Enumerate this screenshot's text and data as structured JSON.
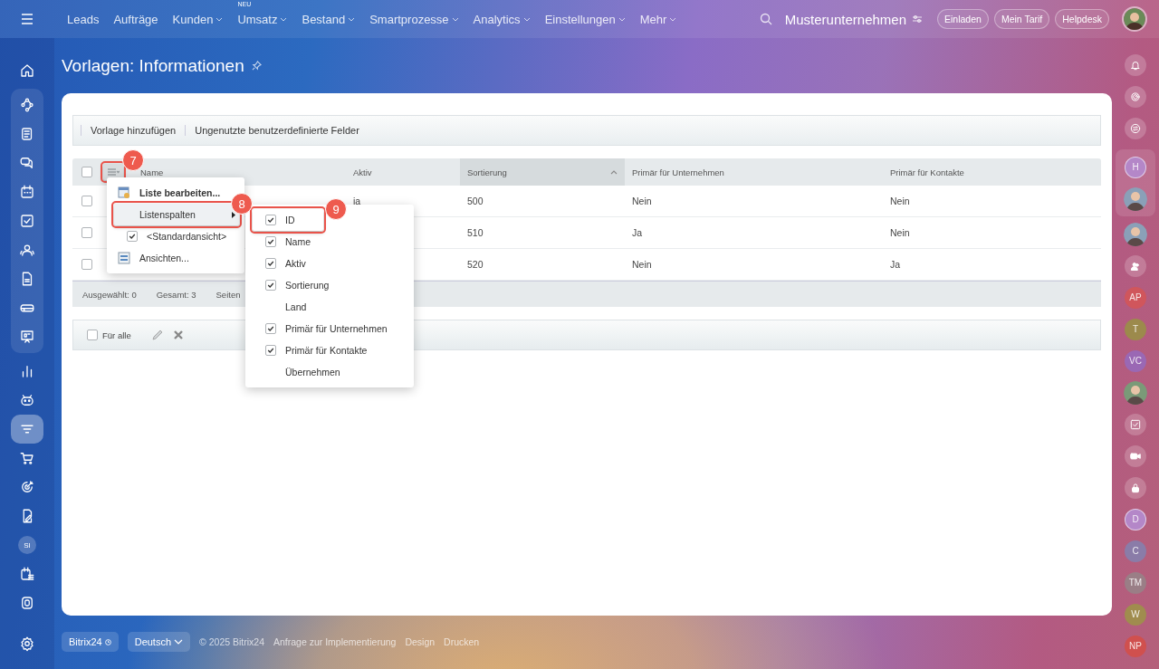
{
  "top_bar": {
    "nav": [
      {
        "label": "Leads",
        "dropdown": false
      },
      {
        "label": "Aufträge",
        "dropdown": false
      },
      {
        "label": "Kunden",
        "dropdown": true
      },
      {
        "label": "Umsatz",
        "dropdown": true,
        "badge": "NEU"
      },
      {
        "label": "Bestand",
        "dropdown": true
      },
      {
        "label": "Smartprozesse",
        "dropdown": true
      },
      {
        "label": "Analytics",
        "dropdown": true
      },
      {
        "label": "Einstellungen",
        "dropdown": true
      },
      {
        "label": "Mehr",
        "dropdown": true
      }
    ],
    "company": "Musterunternehmen",
    "buttons": [
      "Einladen",
      "Mein Tarif",
      "Helpdesk"
    ]
  },
  "left_sidebar": {
    "top": [
      {
        "kind": "home"
      }
    ],
    "group": [
      {
        "kind": "flow"
      },
      {
        "kind": "news"
      },
      {
        "kind": "chat"
      },
      {
        "kind": "calendar"
      },
      {
        "kind": "task"
      },
      {
        "kind": "people"
      },
      {
        "kind": "document"
      },
      {
        "kind": "drive"
      },
      {
        "kind": "board"
      }
    ],
    "rest": [
      {
        "kind": "chart",
        "selected": false
      },
      {
        "kind": "robot",
        "selected": false
      },
      {
        "kind": "filter",
        "selected": true
      },
      {
        "kind": "cart",
        "selected": false
      },
      {
        "kind": "target",
        "selected": false
      },
      {
        "kind": "sign",
        "selected": false
      },
      {
        "kind": "initials",
        "text": "SI"
      },
      {
        "kind": "schedule",
        "selected": false
      },
      {
        "kind": "shield",
        "selected": false
      }
    ],
    "bottom": [
      {
        "kind": "settings"
      }
    ]
  },
  "page_title": "Vorlagen: Informationen",
  "toolbar": [
    "Vorlage hinzufügen",
    "Ungenutzte benutzerdefinierte Felder"
  ],
  "table": {
    "settings_callout": "7",
    "select_all_checked": false,
    "columns": [
      {
        "label": "Name",
        "sorted": false
      },
      {
        "label": "Aktiv",
        "sorted": false
      },
      {
        "label": "Sortierung",
        "sorted": true
      },
      {
        "label": "Primär für Unternehmen",
        "sorted": false
      },
      {
        "label": "Primär für Kontakte",
        "sorted": false
      }
    ],
    "rows": [
      {
        "checked": false,
        "cells": [
          "",
          "ja",
          "500",
          "Nein",
          "Nein"
        ]
      },
      {
        "checked": false,
        "cells": [
          "",
          "",
          "510",
          "Ja",
          "Nein"
        ]
      },
      {
        "checked": false,
        "cells": [
          "",
          "",
          "520",
          "Nein",
          "Ja"
        ]
      }
    ],
    "footer": [
      "Ausgewählt: 0",
      "Gesamt: 3",
      "Seiten"
    ]
  },
  "bottom_toolbar": {
    "label": "Für alle",
    "checked": false
  },
  "settings_menu": {
    "items": [
      {
        "kind": "edit",
        "label": "Liste bearbeiten...",
        "selected": false
      },
      {
        "kind": "submenu",
        "label": "Listenspalten",
        "callout": "8",
        "selected": true
      },
      {
        "kind": "check",
        "label": "<Standardansicht>",
        "checked": true,
        "selected": false
      },
      {
        "kind": "views",
        "label": "Ansichten...",
        "selected": false
      }
    ]
  },
  "columns_menu": {
    "items": [
      {
        "label": "ID",
        "checked": true,
        "callout": "9"
      },
      {
        "label": "Name",
        "checked": true
      },
      {
        "label": "Aktiv",
        "checked": true
      },
      {
        "label": "Sortierung",
        "checked": true
      },
      {
        "label": "Land",
        "checked": false
      },
      {
        "label": "Primär für Unternehmen",
        "checked": true
      },
      {
        "label": "Primär für Kontakte",
        "checked": true
      },
      {
        "label": "Übernehmen",
        "checked": false
      }
    ]
  },
  "right_sidebar": {
    "top": [
      {
        "kind": "bell"
      },
      {
        "kind": "dial"
      },
      {
        "kind": "swap"
      }
    ],
    "group": [
      {
        "kind": "outlined",
        "text": "H",
        "color": "#b487c8"
      },
      {
        "kind": "photo"
      }
    ],
    "rest": [
      {
        "kind": "photo"
      },
      {
        "kind": "team"
      },
      {
        "kind": "initials",
        "text": "AP",
        "color": "#d0565c"
      },
      {
        "kind": "initials",
        "text": "T",
        "color": "#9c8a4c"
      },
      {
        "kind": "initials",
        "text": "VC",
        "color": "#9a68b4"
      },
      {
        "kind": "photo"
      },
      {
        "kind": "task"
      },
      {
        "kind": "video"
      },
      {
        "kind": "lock"
      },
      {
        "kind": "outlined",
        "text": "D",
        "color": "#b487c8"
      },
      {
        "kind": "initials",
        "text": "C",
        "color": "#8a7ca8"
      },
      {
        "kind": "initials",
        "text": "TM",
        "color": "#9a7e86"
      },
      {
        "kind": "initials",
        "text": "W",
        "color": "#a08c4e"
      },
      {
        "kind": "initials",
        "text": "NP",
        "color": "#d0504e"
      }
    ]
  },
  "footer": {
    "brand": "Bitrix24",
    "language": "Deutsch",
    "copyright": "© 2025 Bitrix24",
    "links": [
      "Anfrage zur Implementierung",
      "Design",
      "Drucken"
    ]
  }
}
